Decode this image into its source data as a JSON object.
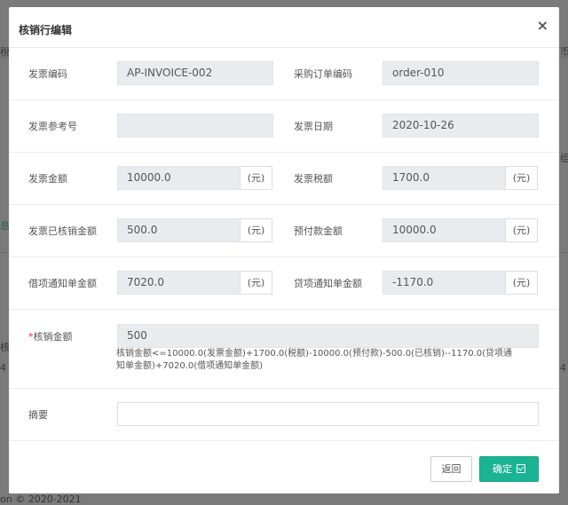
{
  "background": {
    "top_fragment": "",
    "left_fragments": [
      "稅",
      "息",
      "核",
      "4"
    ],
    "right_fragments": [
      "币",
      "组",
      "4"
    ],
    "footer": "on © 2020-2021"
  },
  "modal": {
    "title": "核销行编辑",
    "close_label": "×",
    "fields": {
      "invoice_code": {
        "label": "发票编码",
        "value": "AP-INVOICE-002"
      },
      "po_code": {
        "label": "采购订单编码",
        "value": "order-010"
      },
      "invoice_ref": {
        "label": "发票参考号",
        "value": ""
      },
      "invoice_date": {
        "label": "发票日期",
        "value": "2020-10-26"
      },
      "invoice_amount": {
        "label": "发票金额",
        "value": "10000.0",
        "unit": "(元)"
      },
      "invoice_tax": {
        "label": "发票税额",
        "value": "1700.0",
        "unit": "(元)"
      },
      "written_off": {
        "label": "发票已核销金额",
        "value": "500.0",
        "unit": "(元)"
      },
      "prepaid": {
        "label": "预付款金额",
        "value": "10000.0",
        "unit": "(元)"
      },
      "debit_note": {
        "label": "借项通知单金额",
        "value": "7020.0",
        "unit": "(元)"
      },
      "credit_note": {
        "label": "贷项通知单金额",
        "value": "-1170.0",
        "unit": "(元)"
      },
      "writeoff_amount": {
        "required_mark": "*",
        "label": "核销金额",
        "value": "500"
      },
      "summary": {
        "label": "摘要",
        "value": ""
      }
    },
    "hint": "核销金额<=10000.0(发票金额)+1700.0(税额)-10000.0(预付款)-500.0(已核销)--1170.0(贷项通知单金额)+7020.0(借项通知单金额)",
    "buttons": {
      "back": "返回",
      "confirm": "确定"
    }
  }
}
